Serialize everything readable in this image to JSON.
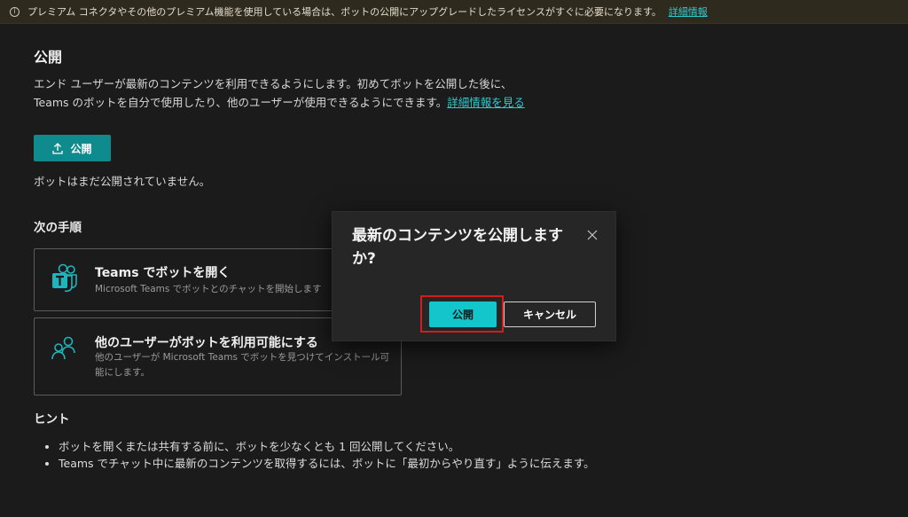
{
  "banner": {
    "icon": "info-icon",
    "text": "プレミアム コネクタやその他のプレミアム機能を使用している場合は、ボットの公開にアップグレードしたライセンスがすぐに必要になります。",
    "link": "詳細情報"
  },
  "main": {
    "title": "公開",
    "description_line1": "エンド ユーザーが最新のコンテンツを利用できるようにします。初めてボットを公開した後に、",
    "description_line2": "Teams のボットを自分で使用したり、他のユーザーが使用できるようにできます。",
    "description_link": "詳細情報を見る",
    "publish_button": "公開",
    "status": "ボットはまだ公開されていません。"
  },
  "next_steps": {
    "heading": "次の手順",
    "cards": [
      {
        "icon": "teams-icon",
        "title": "Teams でボットを開く",
        "desc": "Microsoft Teams でボットとのチャットを開始します"
      },
      {
        "icon": "users-icon",
        "title": "他のユーザーがボットを利用可能にする",
        "desc": "他のユーザーが Microsoft Teams でボットを見つけてインストール可能にします。"
      }
    ]
  },
  "hints": {
    "heading": "ヒント",
    "items": [
      "ボットを開くまたは共有する前に、ボットを少なくとも 1 回公開してください。",
      "Teams でチャット中に最新のコンテンツを取得するには、ボットに「最初からやり直す」ように伝えます。"
    ]
  },
  "dialog": {
    "title": "最新のコンテンツを公開しますか?",
    "confirm_button": "公開",
    "cancel_button": "キャンセル",
    "close_icon": "close-icon",
    "highlight_color": "#d21d1d"
  },
  "colors": {
    "accent": "#13c6cb",
    "primary_button": "#0f8b8d",
    "link": "#2fc9d0",
    "background": "#1b1b1b"
  }
}
